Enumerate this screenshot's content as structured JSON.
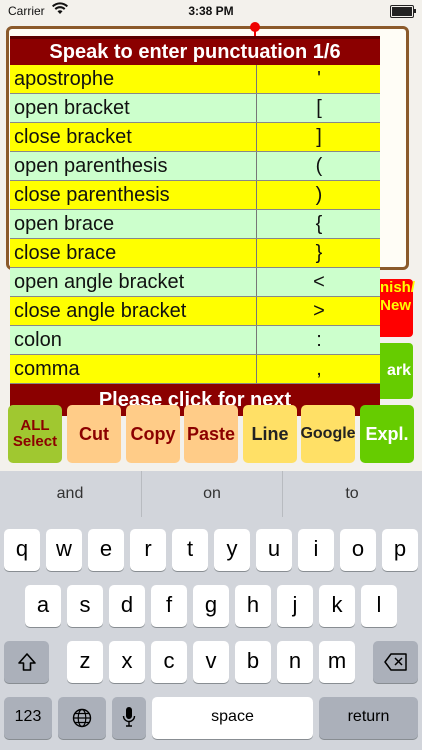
{
  "status": {
    "carrier": "Carrier",
    "time": "3:38 PM"
  },
  "popup": {
    "title": "Speak to enter punctuation 1/6",
    "rows": [
      {
        "word": "apostrophe",
        "symbol": "'"
      },
      {
        "word": "open bracket",
        "symbol": "["
      },
      {
        "word": "close bracket",
        "symbol": "]"
      },
      {
        "word": "open parenthesis",
        "symbol": "("
      },
      {
        "word": "close parenthesis",
        "symbol": ")"
      },
      {
        "word": "open brace",
        "symbol": "{"
      },
      {
        "word": "close brace",
        "symbol": "}"
      },
      {
        "word": "open angle bracket",
        "symbol": "<"
      },
      {
        "word": "close angle bracket",
        "symbol": ">"
      },
      {
        "word": "colon",
        "symbol": ":"
      },
      {
        "word": "comma",
        "symbol": ","
      }
    ],
    "footer": "Please click for next"
  },
  "side": {
    "finish_l1": "nish/",
    "finish_l2": "New",
    "mark": "ark"
  },
  "tools": {
    "all_l1": "ALL",
    "all_l2": "Select",
    "cut": "Cut",
    "copy": "Copy",
    "paste": "Paste",
    "line": "Line",
    "google": "Google",
    "expl": "Expl."
  },
  "keyboard": {
    "suggestions": [
      "and",
      "on",
      "to"
    ],
    "row1": [
      "q",
      "w",
      "e",
      "r",
      "t",
      "y",
      "u",
      "i",
      "o",
      "p"
    ],
    "row2": [
      "a",
      "s",
      "d",
      "f",
      "g",
      "h",
      "j",
      "k",
      "l"
    ],
    "row3": [
      "z",
      "x",
      "c",
      "v",
      "b",
      "n",
      "m"
    ],
    "numbers": "123",
    "space": "space",
    "return": "return"
  }
}
